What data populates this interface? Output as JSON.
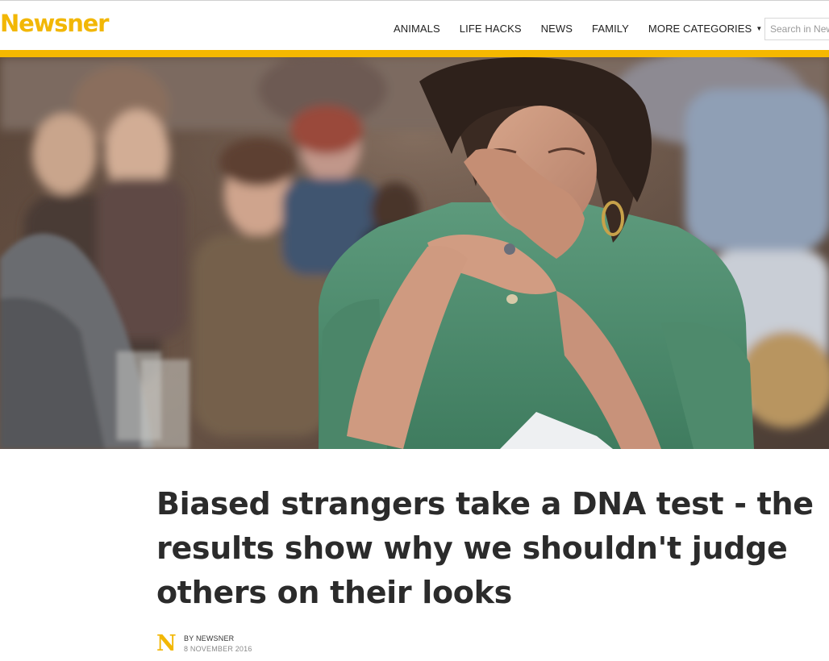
{
  "header": {
    "logo": "Newsner",
    "nav": [
      {
        "label": "ANIMALS"
      },
      {
        "label": "LIFE HACKS"
      },
      {
        "label": "NEWS"
      },
      {
        "label": "FAMILY"
      },
      {
        "label": "MORE CATEGORIES"
      }
    ],
    "more_caret": "▼",
    "search_placeholder": "Search in Newsner"
  },
  "colors": {
    "brand_yellow": "#f2b705",
    "bar_yellow": "#f5b800",
    "headline_text": "#2b2b2b"
  },
  "article": {
    "title": "Biased strangers take a DNA test - the results show why we shouldn't judge others on their looks",
    "author_logo": "N",
    "byline": "BY NEWSNER",
    "date": "8 NOVEMBER 2016"
  }
}
